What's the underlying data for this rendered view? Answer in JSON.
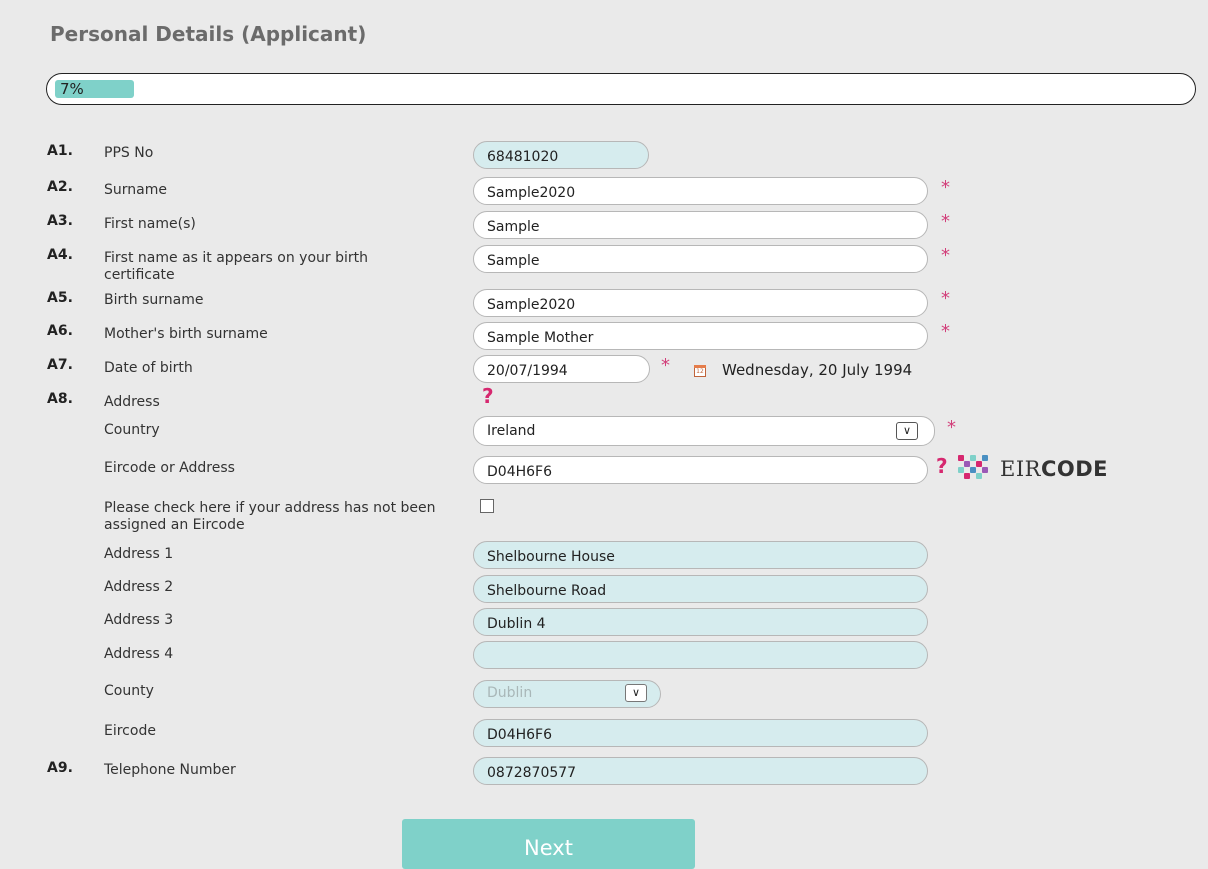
{
  "page": {
    "title": "Personal Details (Applicant)"
  },
  "progress": {
    "percent": 7,
    "label": "7%"
  },
  "rows": [
    {
      "num": "A1.",
      "label": "PPS No",
      "value": "68481020"
    },
    {
      "num": "A2.",
      "label": "Surname",
      "value": "Sample2020",
      "required_mark": "*"
    },
    {
      "num": "A3.",
      "label": "First name(s)",
      "value": "Sample",
      "required_mark": "*"
    },
    {
      "num": "A4.",
      "label": "First name as it appears on your birth certificate",
      "value": "Sample",
      "required_mark": "*"
    },
    {
      "num": "A5.",
      "label": "Birth surname",
      "value": "Sample2020",
      "required_mark": "*"
    },
    {
      "num": "A6.",
      "label": "Mother's birth surname",
      "value": "Sample Mother",
      "required_mark": "*"
    },
    {
      "num": "A7.",
      "label": "Date of birth",
      "value": "20/07/1994",
      "required_mark": "*",
      "long_date": "Wednesday, 20 July 1994",
      "calendar_icon_text": "12"
    },
    {
      "num": "A8.",
      "label": "Address",
      "help_mark": "?"
    },
    {
      "num": "A9.",
      "label": "Telephone Number",
      "value": "0872870577"
    }
  ],
  "address": {
    "country": {
      "label": "Country",
      "value": "Ireland",
      "required_mark": "*",
      "arrow": "∨"
    },
    "eircode_or_address": {
      "label": "Eircode or Address",
      "value": "D04H6F6",
      "help_mark": "?"
    },
    "no_eircode_check": {
      "label": "Please check here if your address has not been assigned an Eircode",
      "checked": false
    },
    "address_1": {
      "label": "Address 1",
      "value": "Shelbourne House"
    },
    "address_2": {
      "label": "Address 2",
      "value": "Shelbourne Road"
    },
    "address_3": {
      "label": "Address 3",
      "value": "Dublin 4"
    },
    "address_4": {
      "label": "Address 4",
      "value": ""
    },
    "county": {
      "label": "County",
      "value": "Dublin",
      "arrow": "∨"
    },
    "eircode": {
      "label": "Eircode",
      "value": "D04H6F6"
    }
  },
  "eircode_brand": {
    "text_light": "EIR",
    "text_bold": "CODE",
    "logo_colors": [
      "#d6286f",
      "#7fd1c9",
      "#4a90c2",
      "#9b59b6"
    ]
  },
  "buttons": {
    "next": "Next"
  },
  "colors": {
    "accent": "#7fd1c9",
    "required": "#d23f7a",
    "readonly_field": "#d6ecee"
  }
}
